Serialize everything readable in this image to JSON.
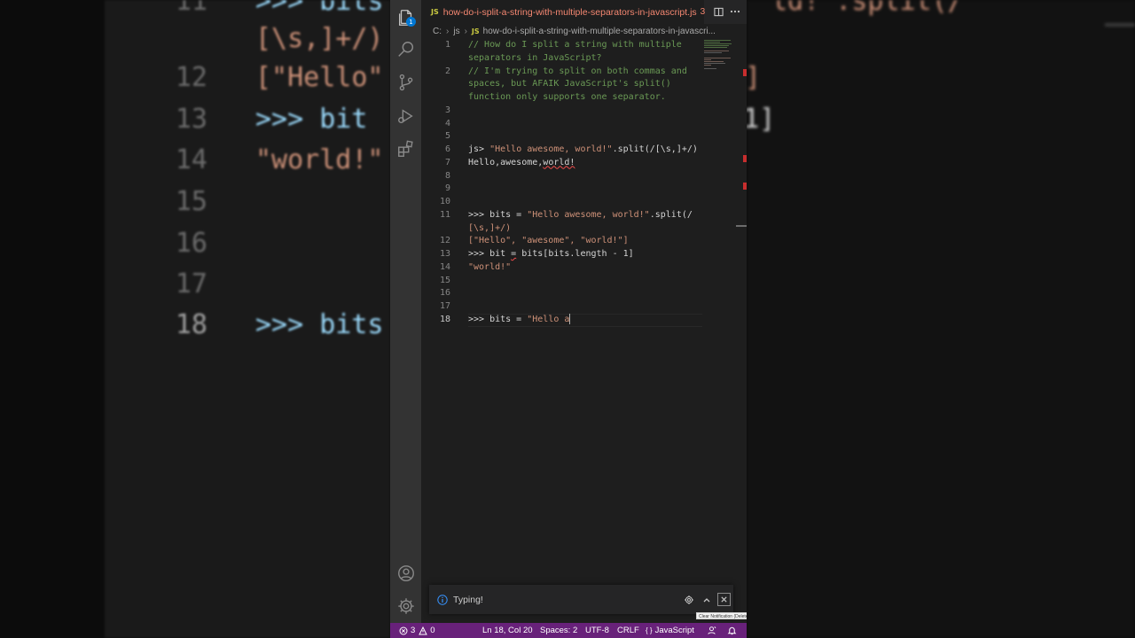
{
  "window": {
    "tab_title": "how-do-i-split-a-string-with-multiple-separators-in-javascript.js",
    "tab_problem_count": "3",
    "js_badge": "JS",
    "explorer_badge": "1"
  },
  "breadcrumb": {
    "drive": "C:",
    "folder": "js",
    "file": "how-do-i-split-a-string-with-multiple-separators-in-javascri..."
  },
  "gutter": {
    "line_numbers": [
      "1",
      "2",
      "3",
      "4",
      "5",
      "6",
      "7",
      "8",
      "9",
      "10",
      "11",
      "12",
      "13",
      "14",
      "15",
      "16",
      "17",
      "18"
    ],
    "active_line": "18"
  },
  "code": {
    "l1": "// How do I split a string with multiple",
    "l1b": "separators in JavaScript?",
    "l2": "// I'm trying to split on both commas and",
    "l2b": "spaces, but AFAIK JavaScript's split()",
    "l2c": "function only supports one separator.",
    "l6_prompt": "js> ",
    "l6_str": "\"Hello awesome, world!\"",
    "l6_rest": ".split(/[\\s,]+/)",
    "l7_a": "Hello,awesome,",
    "l7_b": "world!",
    "l11_a": ">>> bits = ",
    "l11_str": "\"Hello awesome, world!\"",
    "l11_rest": ".split(/",
    "l11b": "[\\s,]+/)",
    "l12": "[\"Hello\", \"awesome\", \"world!\"]",
    "l13_a": ">>> bit ",
    "l13_eq": "=",
    "l13_b": " bits[bits.length - 1]",
    "l14": "\"world!\"",
    "l18_a": ">>> bits = ",
    "l18_str": "\"Hello a"
  },
  "backdrop": {
    "left_lines": [
      {
        "num": "11",
        "text": ">>> bits"
      },
      {
        "num": "",
        "text": "[\\s,]+/)"
      },
      {
        "num": "12",
        "text": "[\"Hello\""
      },
      {
        "num": "13",
        "text": ">>> bit"
      },
      {
        "num": "14",
        "text": "\"world!\""
      },
      {
        "num": "15",
        "text": ""
      },
      {
        "num": "16",
        "text": ""
      },
      {
        "num": "17",
        "text": ""
      },
      {
        "num": "18",
        "text": ">>> bits"
      }
    ],
    "right_lines": [
      "ld!\".split(/",
      "\"]",
      "- 1]"
    ]
  },
  "notification": {
    "message": "Typing!",
    "tooltip": "Clear Notification (Delete)"
  },
  "statusbar": {
    "errors": "3",
    "warnings": "0",
    "position": "Ln 18, Col 20",
    "spaces": "Spaces: 2",
    "encoding": "UTF-8",
    "eol": "CRLF",
    "language_braces": "{ }",
    "language": "JavaScript"
  },
  "colors": {
    "statusbar": "#68217a",
    "comment": "#6a9955",
    "string": "#ce9178",
    "accent": "#0078d4",
    "error": "#f14c4c"
  }
}
